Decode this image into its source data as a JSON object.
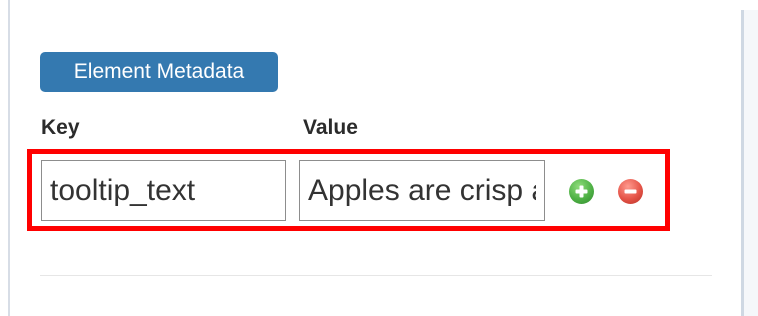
{
  "section": {
    "title": "Element Metadata"
  },
  "columns": {
    "key_label": "Key",
    "value_label": "Value"
  },
  "metadata_row": {
    "key_value": "tooltip_text",
    "value_value": "Apples are crisp and sweet"
  },
  "actions": {
    "add_icon": "plus-circle-icon",
    "remove_icon": "minus-circle-icon"
  },
  "colors": {
    "badge": "#3479b0",
    "highlight": "#ff0000",
    "add_button": "#4fb146",
    "remove_button": "#e55448"
  }
}
